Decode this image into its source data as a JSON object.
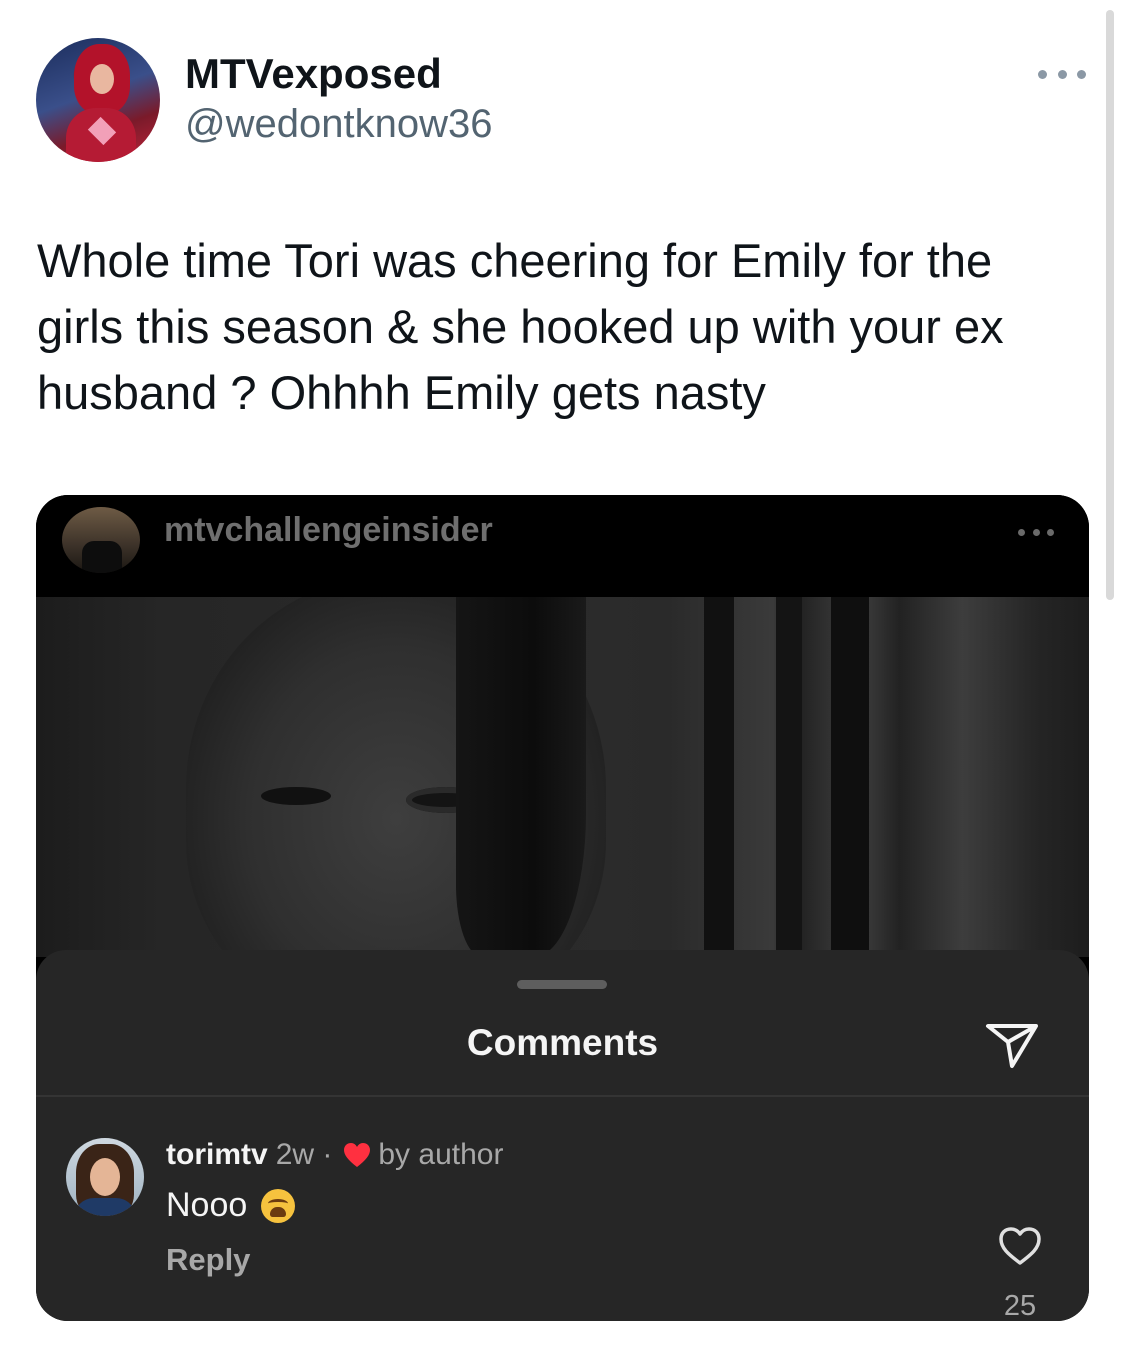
{
  "tweet": {
    "display_name": "MTVexposed",
    "handle": "@wedontknow36",
    "text": "Whole time Tori was cheering for Emily for the girls this season & she hooked up with your ex husband ? Ohhhh Emily gets nasty",
    "more_icon": "more-horizontal-icon"
  },
  "embedded_post": {
    "username": "mtvchallengeinsider",
    "more_icon": "more-horizontal-icon",
    "sheet_title": "Comments",
    "send_icon": "paper-plane-icon",
    "comment": {
      "user": "torimtv",
      "time": "2w ·",
      "liked_by_author_icon": "red-heart-icon",
      "by_author": "by author",
      "text": "Nooo",
      "emoji": "weary-face-emoji",
      "reply_label": "Reply",
      "like_icon": "heart-outline-icon",
      "like_count": "25"
    }
  },
  "colors": {
    "primary_text": "#0f1419",
    "secondary_text": "#536471",
    "sheet_bg": "#262626",
    "heart_red": "#ff3040"
  }
}
